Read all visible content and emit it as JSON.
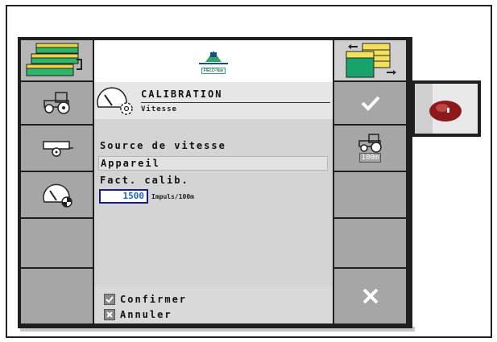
{
  "header": {
    "title": "CALIBRATION",
    "subtitle": "Vitesse",
    "logo_text": "FIELD-Nav"
  },
  "form": {
    "speed_source_label": "Source de vitesse",
    "speed_source_value": "Appareil",
    "factor_label": "Fact. calib.",
    "factor_value": "1500",
    "factor_unit": "Impuls/100m"
  },
  "footer": {
    "confirm_label": "Confirmer",
    "cancel_label": "Annuler"
  },
  "right_buttons": {
    "speed_button_label": "100m"
  },
  "colors": {
    "blue": "#1565c0",
    "yellow": "#f2e15a",
    "green": "#17a36b",
    "dark": "#1f1f1f",
    "button_gray": "#a6a6a6"
  }
}
